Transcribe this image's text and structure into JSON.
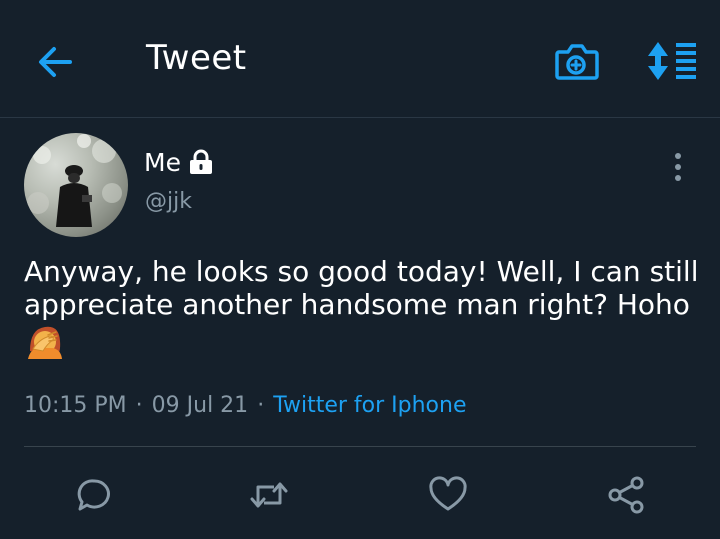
{
  "header": {
    "title": "Tweet",
    "back_icon": "arrow-left-icon",
    "camera_icon": "camera-add-icon",
    "sort_icon": "sort-list-icon",
    "accent": "#1da1f2"
  },
  "tweet": {
    "author_name": "Me",
    "lock_icon": "lock-icon",
    "handle": "@jjk",
    "text": "Anyway, he looks so good today! Well, I can still appreciate another handsome man right? Hoho",
    "emoji_icon": "facepalm-emoji",
    "time": "10:15 PM",
    "date": "09 Jul 21",
    "separator": "·",
    "source": "Twitter for Iphone"
  },
  "actions": [
    {
      "icon": "reply-icon"
    },
    {
      "icon": "retweet-icon"
    },
    {
      "icon": "like-icon"
    },
    {
      "icon": "share-icon"
    }
  ],
  "colors": {
    "background": "#15202b",
    "secondary_text": "#8899a6",
    "divider": "#38444d"
  }
}
